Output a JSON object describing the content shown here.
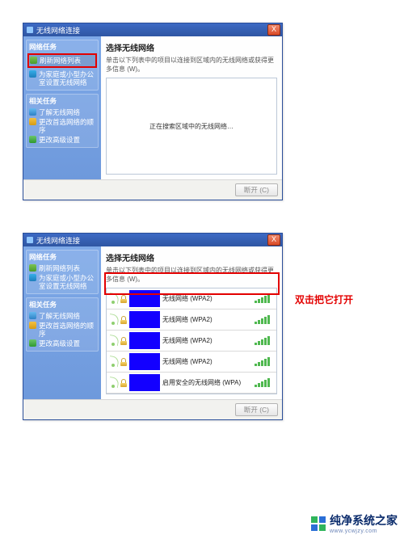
{
  "window1": {
    "title": "无线网络连接",
    "close": "X",
    "sidebar": {
      "section1_title": "网络任务",
      "refresh": "刷新网络列表",
      "office": "为家庭或小型办公室设置无线网络",
      "section2_title": "相关任务",
      "learn": "了解无线网络",
      "pref": "更改首选网络的顺序",
      "advanced": "更改高级设置"
    },
    "main": {
      "heading": "选择无线网络",
      "sub": "单击以下列表中的项目以连接到区域内的无线网络或获得更多信息 (W)。",
      "empty_msg": "正在搜索区域中的无线网络…"
    },
    "footer_btn": "断开 (C)"
  },
  "window2": {
    "title": "无线网络连接",
    "close": "X",
    "sidebar": {
      "section1_title": "网络任务",
      "refresh": "刷新网络列表",
      "office": "为家庭或小型办公室设置无线网络",
      "section2_title": "相关任务",
      "learn": "了解无线网络",
      "pref": "更改首选网络的顺序",
      "advanced": "更改高级设置"
    },
    "main": {
      "heading": "选择无线网络",
      "sub": "单击以下列表中的项目以连接到区域内的无线网络或获得更多信息 (W)。"
    },
    "networks": [
      {
        "label": "无线网络 (WPA2)"
      },
      {
        "label": "无线网络 (WPA2)"
      },
      {
        "label": "无线网络 (WPA2)"
      },
      {
        "label": "无线网络 (WPA2)"
      },
      {
        "label": "启用安全的无线网络 (WPA)"
      }
    ],
    "footer_btn": "断开 (C)"
  },
  "annotation": "双击把它打开",
  "watermark": {
    "brand": "纯净系统之家",
    "url": "www.ycwjzy.com"
  }
}
